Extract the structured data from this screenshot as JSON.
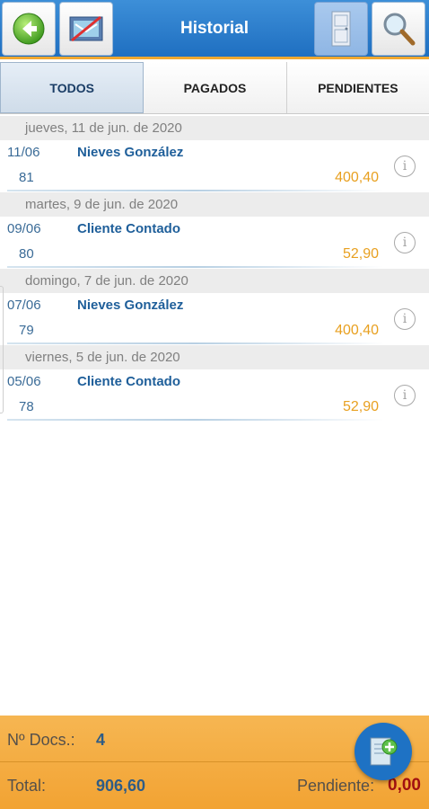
{
  "header": {
    "title": "Historial",
    "back_icon": "back-arrow-icon",
    "cancel_icon": "cancel-document-icon",
    "door_icon": "door-icon",
    "search_icon": "magnifier-icon"
  },
  "tabs": [
    {
      "label": "TODOS",
      "active": true
    },
    {
      "label": "PAGADOS",
      "active": false
    },
    {
      "label": "PENDIENTES",
      "active": false
    }
  ],
  "groups": [
    {
      "header": "jueves, 11 de jun. de 2020",
      "row": {
        "date": "11/06",
        "number": "81",
        "client": "Nieves González",
        "amount": "400,40"
      }
    },
    {
      "header": "martes, 9 de jun. de 2020",
      "row": {
        "date": "09/06",
        "number": "80",
        "client": "Cliente Contado",
        "amount": "52,90"
      }
    },
    {
      "header": "domingo, 7 de jun. de 2020",
      "row": {
        "date": "07/06",
        "number": "79",
        "client": "Nieves González",
        "amount": "400,40"
      }
    },
    {
      "header": "viernes, 5 de jun. de 2020",
      "row": {
        "date": "05/06",
        "number": "78",
        "client": "Cliente Contado",
        "amount": "52,90"
      }
    }
  ],
  "footer": {
    "docs_label": "Nº Docs.:",
    "docs_value": "4",
    "total_label": "Total:",
    "total_value": "906,60",
    "pending_label": "Pendiente:",
    "pending_value": "0,00"
  },
  "colors": {
    "header_blue": "#1f6fc1",
    "footer_orange": "#f2a333",
    "amount_orange": "#e8a020",
    "client_blue": "#1f5f9a",
    "pending_red": "#a11010"
  }
}
